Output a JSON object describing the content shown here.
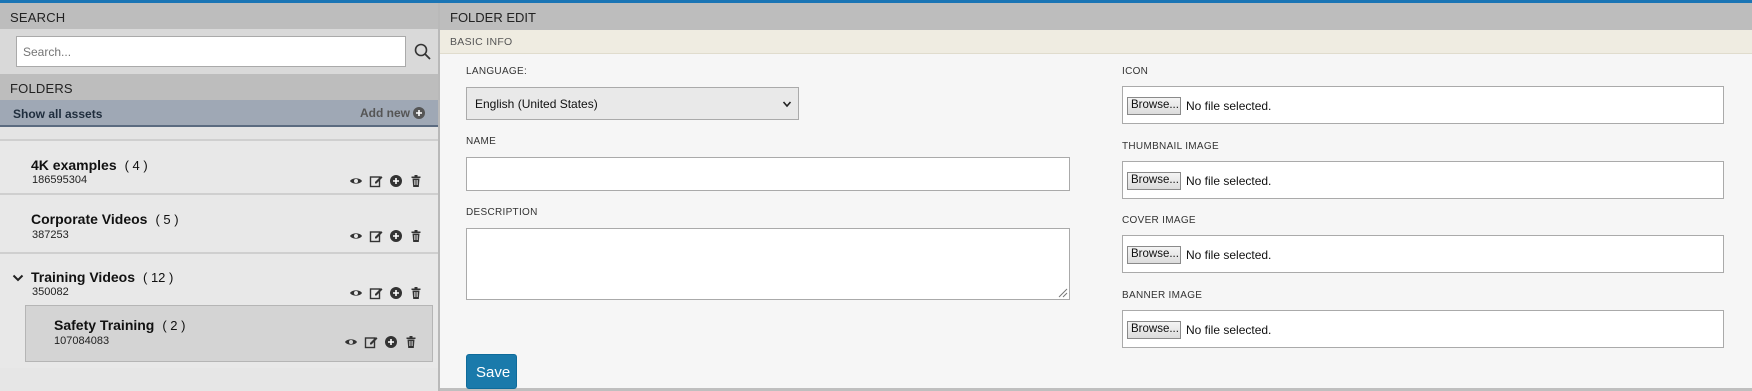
{
  "sidebar": {
    "search_header": "SEARCH",
    "search_placeholder": "Search...",
    "folders_header": "FOLDERS",
    "show_all": "Show all assets",
    "add_new": "Add new",
    "folders": [
      {
        "name": "4K examples",
        "count": "( 4 )",
        "id": "186595304"
      },
      {
        "name": "Corporate Videos",
        "count": "( 5 )",
        "id": "387253"
      },
      {
        "name": "Training Videos",
        "count": "( 12 )",
        "id": "350082",
        "expanded": true
      },
      {
        "name": "Safety Training",
        "count": "( 2 )",
        "id": "107084083",
        "child_of": "Training Videos"
      }
    ]
  },
  "editor": {
    "header": "FOLDER EDIT",
    "section": "BASIC INFO",
    "language_label": "LANGUAGE:",
    "language_value": "English (United States)",
    "name_label": "NAME",
    "name_value": "",
    "description_label": "DESCRIPTION",
    "description_value": "",
    "icon_label": "ICON",
    "thumbnail_label": "THUMBNAIL IMAGE",
    "cover_label": "COVER IMAGE",
    "banner_label": "BANNER IMAGE",
    "browse_label": "Browse...",
    "no_file": "No file selected.",
    "save_label": "Save"
  },
  "colors": {
    "accent": "#1a7aab",
    "topline": "#1a75b5"
  }
}
